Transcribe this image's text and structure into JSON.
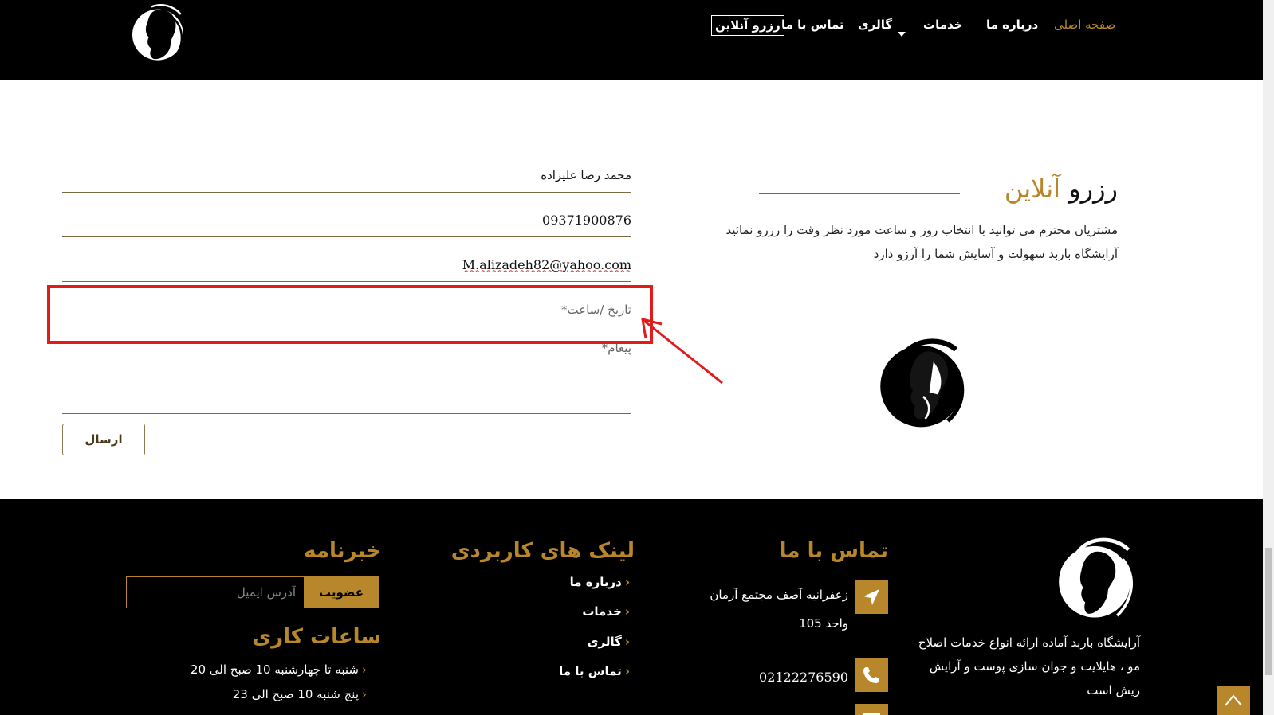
{
  "header": {
    "nav": {
      "home": "صفحه اصلی",
      "about": "درباره ما",
      "services": "خدمات",
      "gallery": "گالری",
      "contact": "تماس با ما",
      "booking": "رزرو آنلاین"
    }
  },
  "reservation": {
    "title_dark": "رزرو",
    "title_gold": "آنلاین",
    "description": "مشتریان محترم می توانید با انتخاب روز و ساعت مورد نظر وقت را رزرو نمائید آرایشگاه باربد سهولت و آسایش شما را آرزو دارد",
    "form": {
      "name_value": "محمد رضا علیزاده",
      "phone_value": "09371900876",
      "email_value": "M.alizadeh82@yahoo.com",
      "datetime_placeholder": "تاریخ /ساعت*",
      "message_placeholder": "پیغام*",
      "submit_label": "ارسال"
    }
  },
  "footer": {
    "about": "آرایشگاه باربد آماده ارائه انواع خدمات اصلاح مو ، هایلایت و جوان سازی پوست و آرایش ریش است",
    "contact": {
      "heading": "تماس با ما",
      "address": "زعفرانیه آصف مجتمع آرمان واحد 105",
      "phone": "02122276590"
    },
    "links": {
      "heading": "لینک های کاربردی",
      "items": [
        "درباره ما",
        "خدمات",
        "گالری",
        "تماس با ما"
      ]
    },
    "newsletter": {
      "heading": "خبرنامه",
      "email_placeholder": "آدرس ایمیل",
      "subscribe_label": "عضویت"
    },
    "hours": {
      "heading": "ساعات کاری",
      "items": [
        "شنبه تا چهارشنبه 10 صبح الی 20",
        "پنج شنبه 10 صبح الی 23"
      ]
    }
  },
  "colors": {
    "gold": "#b8862b",
    "black": "#000000",
    "highlight_red": "#e21a1a"
  },
  "icons": [
    "barber-logo-icon",
    "location-arrow-icon",
    "phone-icon",
    "mail-icon",
    "chevron-left-icon",
    "caret-down-icon",
    "chevron-up-icon"
  ]
}
